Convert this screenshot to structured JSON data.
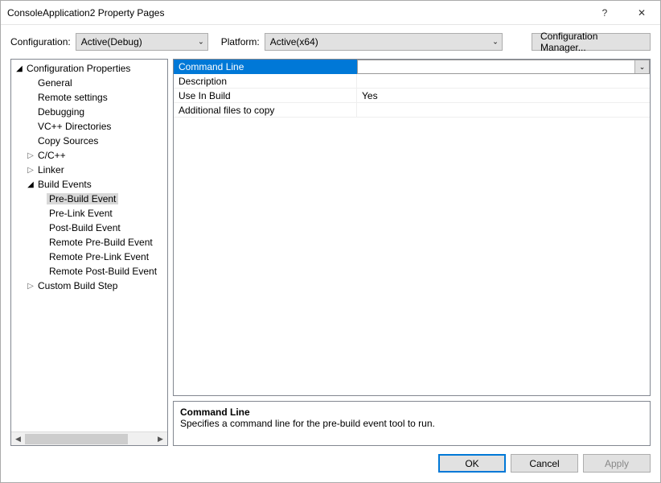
{
  "window": {
    "title": "ConsoleApplication2 Property Pages"
  },
  "toolbar": {
    "config_label": "Configuration:",
    "config_value": "Active(Debug)",
    "platform_label": "Platform:",
    "platform_value": "Active(x64)",
    "cfg_mgr_label": "Configuration Manager..."
  },
  "tree": {
    "root": "Configuration Properties",
    "items": [
      {
        "label": "General",
        "indent": 1,
        "exp": "",
        "sel": false
      },
      {
        "label": "Remote settings",
        "indent": 1,
        "exp": "",
        "sel": false
      },
      {
        "label": "Debugging",
        "indent": 1,
        "exp": "",
        "sel": false
      },
      {
        "label": "VC++ Directories",
        "indent": 1,
        "exp": "",
        "sel": false
      },
      {
        "label": "Copy Sources",
        "indent": 1,
        "exp": "",
        "sel": false
      },
      {
        "label": "C/C++",
        "indent": 1,
        "exp": "closed",
        "sel": false
      },
      {
        "label": "Linker",
        "indent": 1,
        "exp": "closed",
        "sel": false
      },
      {
        "label": "Build Events",
        "indent": 1,
        "exp": "open",
        "sel": false
      },
      {
        "label": "Pre-Build Event",
        "indent": 2,
        "exp": "",
        "sel": true
      },
      {
        "label": "Pre-Link Event",
        "indent": 2,
        "exp": "",
        "sel": false
      },
      {
        "label": "Post-Build Event",
        "indent": 2,
        "exp": "",
        "sel": false
      },
      {
        "label": "Remote Pre-Build Event",
        "indent": 2,
        "exp": "",
        "sel": false
      },
      {
        "label": "Remote Pre-Link Event",
        "indent": 2,
        "exp": "",
        "sel": false
      },
      {
        "label": "Remote Post-Build Event",
        "indent": 2,
        "exp": "",
        "sel": false
      },
      {
        "label": "Custom Build Step",
        "indent": 1,
        "exp": "closed",
        "sel": false
      }
    ]
  },
  "grid": {
    "rows": [
      {
        "name": "Command Line",
        "value": "",
        "selected": true
      },
      {
        "name": "Description",
        "value": "",
        "selected": false
      },
      {
        "name": "Use In Build",
        "value": "Yes",
        "selected": false
      },
      {
        "name": "Additional files to copy",
        "value": "",
        "selected": false
      }
    ]
  },
  "description": {
    "title": "Command Line",
    "text": "Specifies a command line for the pre-build event tool to run."
  },
  "footer": {
    "ok": "OK",
    "cancel": "Cancel",
    "apply": "Apply"
  },
  "glyphs": {
    "help": "?",
    "close": "✕",
    "chev_down": "⌄",
    "tri_right": "▷",
    "tri_down": "◢",
    "left": "◀",
    "right": "▶"
  }
}
